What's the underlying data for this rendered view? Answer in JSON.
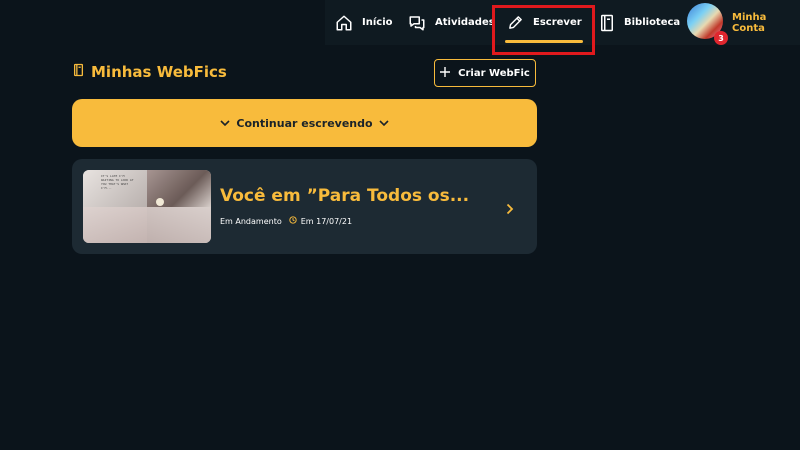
{
  "nav": {
    "inicio": "Início",
    "atividades": "Atividades",
    "escrever": "Escrever",
    "biblioteca": "Biblioteca",
    "account_label": "Minha Conta",
    "notification_count": "3"
  },
  "main": {
    "section_title": "Minhas WebFics",
    "create_button": "Criar WebFic",
    "continue_button": "Continuar escrevendo"
  },
  "story": {
    "title": "Você em ”Para Todos os...",
    "status": "Em Andamento",
    "date": "Em 17/07/21"
  },
  "colors": {
    "background": "#0b141b",
    "nav_background": "#0f1a21",
    "accent": "#f8bb3c",
    "card": "#1d2a33",
    "highlight": "#e0191d",
    "badge": "#e0262e"
  },
  "icons": {
    "inicio": "home-icon",
    "atividades": "chat-bubbles-icon",
    "escrever": "pencil-icon",
    "biblioteca": "book-icon",
    "section": "book-icon",
    "create": "plus-icon",
    "continue": "chevron-down-icon",
    "story_open": "chevron-right-icon",
    "date": "clock-icon"
  }
}
